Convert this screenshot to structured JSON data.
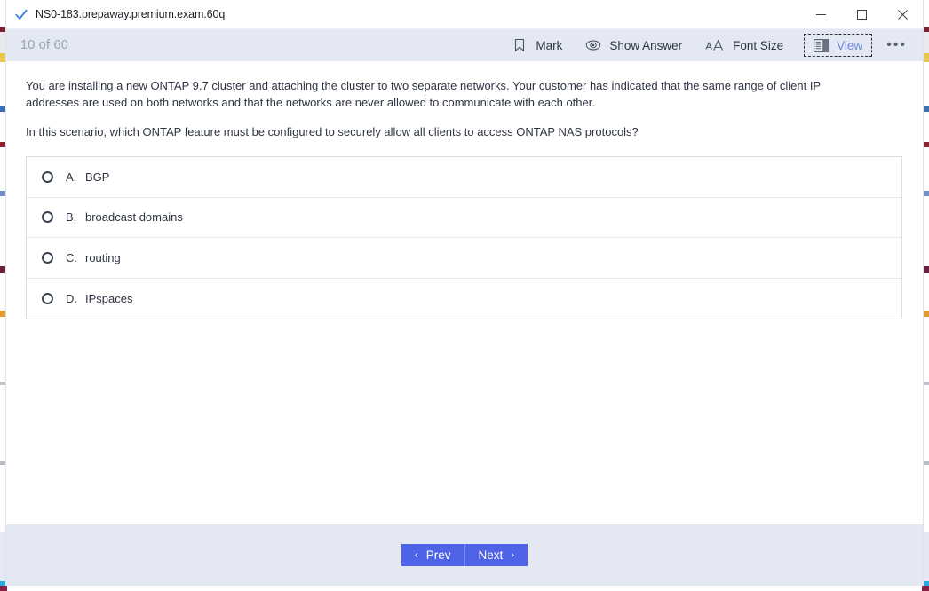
{
  "window": {
    "title": "NS0-183.prepaway.premium.exam.60q",
    "app_icon": "checkmark-icon",
    "controls": {
      "minimize": "–",
      "maximize": "☐",
      "close": "×"
    }
  },
  "toolbar": {
    "progress": "10 of 60",
    "current_question": 10,
    "total_questions": 60,
    "actions": [
      {
        "id": "mark",
        "label": "Mark",
        "icon": "bookmark-icon"
      },
      {
        "id": "show-answer",
        "label": "Show Answer",
        "icon": "eye-icon"
      },
      {
        "id": "font-size",
        "label": "Font Size",
        "icon": "font-size-icon"
      },
      {
        "id": "view",
        "label": "View",
        "icon": "layout-panel-icon",
        "focused": true
      },
      {
        "id": "more",
        "label": "•••",
        "icon": "ellipsis-icon"
      }
    ]
  },
  "question": {
    "paragraph1": "You are installing a new ONTAP 9.7 cluster and attaching the cluster to two separate networks. Your customer has indicated that the same range of client IP addresses are used on both networks and that the networks are never allowed to communicate with each other.",
    "paragraph2": "In this scenario, which ONTAP feature must be configured to securely allow all clients to access ONTAP NAS protocols?",
    "options": [
      {
        "letter": "A.",
        "label": "BGP",
        "selected": false
      },
      {
        "letter": "B.",
        "label": "broadcast domains",
        "selected": false
      },
      {
        "letter": "C.",
        "label": "routing",
        "selected": false
      },
      {
        "letter": "D.",
        "label": "IPspaces",
        "selected": false
      }
    ]
  },
  "footer": {
    "prev_label": "Prev",
    "next_label": "Next",
    "prev_chevron": "‹",
    "next_chevron": "›"
  },
  "colors": {
    "toolbar_bg": "#e3e8f2",
    "accent_button": "#4e63e8",
    "view_text": "#6f8bdd",
    "text_primary": "#2e3442",
    "progress_text": "#9aa3b2"
  }
}
